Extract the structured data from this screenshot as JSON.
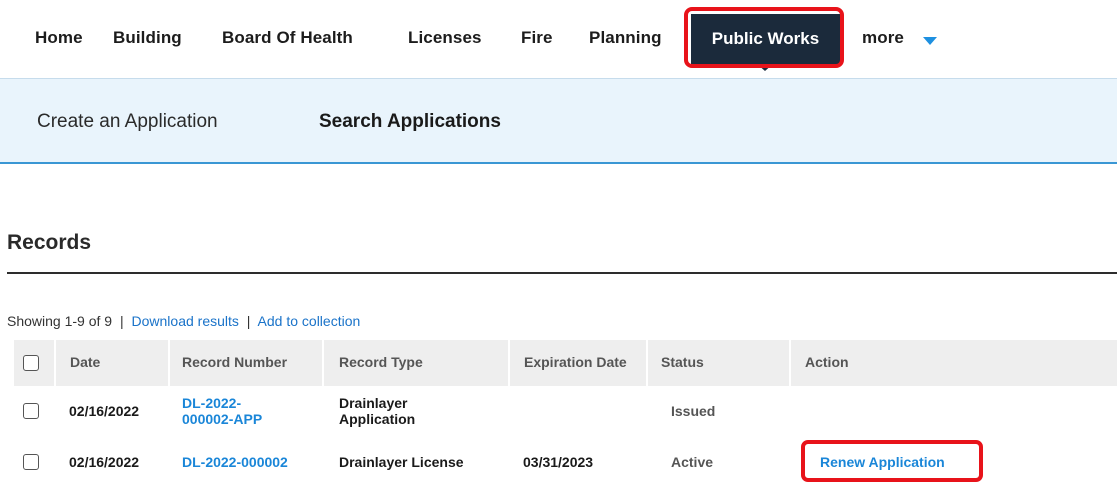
{
  "topnav": {
    "items": [
      "Home",
      "Building",
      "Board Of Health",
      "Licenses",
      "Fire",
      "Planning"
    ],
    "active": "Public Works",
    "more": "more"
  },
  "subnav": {
    "create": "Create an Application",
    "search": "Search Applications"
  },
  "records": {
    "heading": "Records",
    "showing": "Showing 1-9 of 9",
    "download": "Download results",
    "add_collection": "Add to collection",
    "separator": "|"
  },
  "table": {
    "columns": [
      "Date",
      "Record Number",
      "Record Type",
      "Expiration Date",
      "Status",
      "Action"
    ],
    "rows": [
      {
        "date": "02/16/2022",
        "record_number": "DL-2022-000002-APP",
        "record_type": "Drainlayer Application",
        "expiration": "",
        "status": "Issued",
        "action": ""
      },
      {
        "date": "02/16/2022",
        "record_number": "DL-2022-000002",
        "record_type": "Drainlayer License",
        "expiration": "03/31/2023",
        "status": "Active",
        "action": "Renew Application"
      }
    ]
  },
  "colors": {
    "nav_active_bg": "#1b2a3b",
    "highlight_outline": "#e8131a",
    "link": "#1a86d8",
    "subnav_bg": "#e9f4fc",
    "subnav_border": "#3a97d4"
  },
  "icons": {
    "more": "caret-down-icon",
    "checkbox": "checkbox-icon"
  }
}
